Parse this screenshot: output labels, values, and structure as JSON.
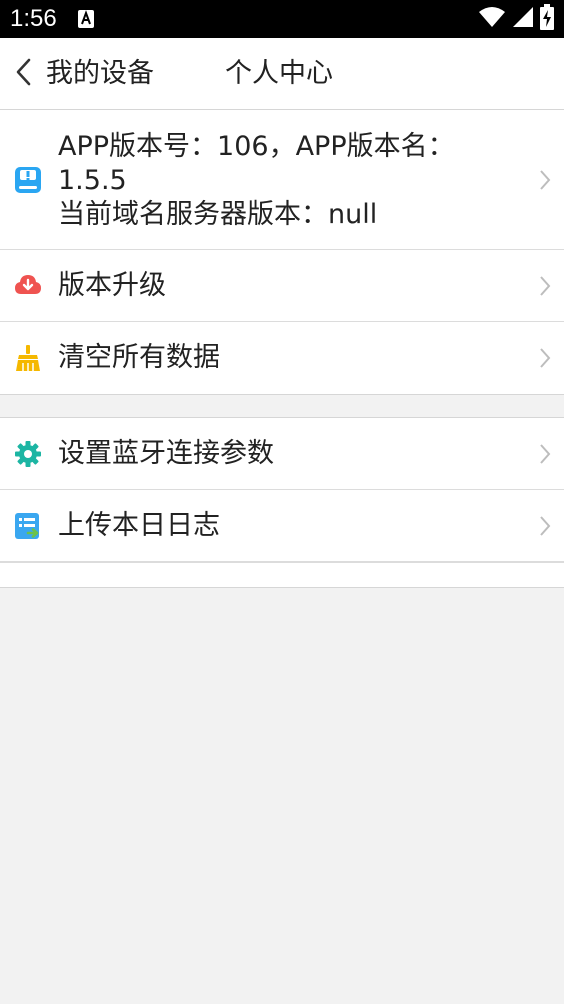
{
  "status_bar": {
    "time": "1:56"
  },
  "header": {
    "back_label": "我的设备",
    "title": "个人中心"
  },
  "info_row": {
    "line1": "APP版本号：106，APP版本名：",
    "line2": "1.5.5",
    "line3": "当前域名服务器版本：null"
  },
  "menu_group_1": [
    {
      "label": "版本升级",
      "icon": "cloud-download-icon",
      "color": "#ef5350"
    },
    {
      "label": "清空所有数据",
      "icon": "broom-icon",
      "color": "#f5b800"
    }
  ],
  "menu_group_2": [
    {
      "label": "设置蓝牙连接参数",
      "icon": "gear-icon",
      "color": "#1cb5a3"
    },
    {
      "label": "上传本日日志",
      "icon": "upload-log-icon",
      "color": "#3aa7f0"
    }
  ],
  "colors": {
    "background": "#f2f2f2",
    "info_icon": "#2aa6f2",
    "chevron": "#bdbdbd"
  }
}
